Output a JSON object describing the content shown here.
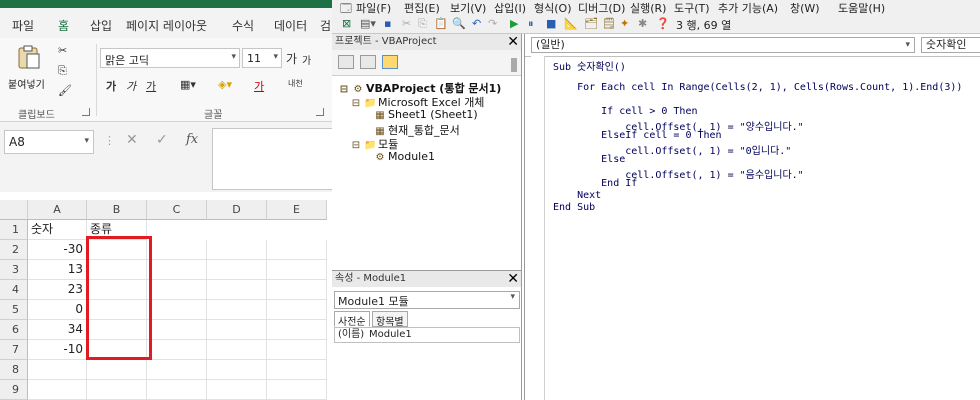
{
  "excel": {
    "tabs": [
      "파일",
      "홈",
      "삽입",
      "페이지 레이아웃",
      "수식",
      "데이터",
      "검"
    ],
    "active_tab": "홈",
    "ribbon": {
      "paste_label": "붙여넣기",
      "clipboard_label": "클립보드",
      "font_label": "글꼴",
      "font_name": "맑은 고딕",
      "font_size": "11",
      "grow_font": "가",
      "shrink_font": "가",
      "bold": "가",
      "italic": "가",
      "underline": "가",
      "font_color": "가",
      "phonetic": "내천"
    },
    "name_box": "A8",
    "fx_label": "fx",
    "columns": [
      "A",
      "B",
      "C",
      "D",
      "E"
    ],
    "rows": [
      "1",
      "2",
      "3",
      "4",
      "5",
      "6",
      "7",
      "8",
      "9"
    ],
    "cells": {
      "A1": "숫자",
      "B1": "종류",
      "A2": "-30",
      "A3": "13",
      "A4": "23",
      "A5": "0",
      "A6": "34",
      "A7": "-10"
    },
    "colors": {
      "excel_green": "#1e7145",
      "highlight": "#e11b22"
    }
  },
  "vbe": {
    "menu": [
      "파일(F)",
      "편집(E)",
      "보기(V)",
      "삽입(I)",
      "형식(O)",
      "디버그(D)",
      "실행(R)",
      "도구(T)",
      "추가 기능(A)",
      "창(W)",
      "도움말(H)"
    ],
    "cursor_pos": "3 행, 69 열",
    "project": {
      "title": "프로젝트 - VBAProject",
      "root": "VBAProject (통합 문서1)",
      "excel_objects": "Microsoft Excel 개체",
      "sheet1": "Sheet1 (Sheet1)",
      "workbook": "현재_통합_문서",
      "modules": "모듈",
      "module1": "Module1"
    },
    "properties": {
      "title": "속성 - Module1",
      "object": "Module1 모듈",
      "tab_alpha": "사전순",
      "tab_category": "항목별",
      "row_name": "(이름)",
      "row_value": "Module1"
    },
    "code": {
      "object_select": "(일반)",
      "procedure_select": "숫자확인",
      "lines": [
        "Sub 숫자확인()",
        "",
        "    For Each cell In Range(Cells(2, 1), Cells(Rows.Count, 1).End(3))",
        "",
        "        If cell > 0 Then",
        "            cell.Offset(, 1) = \"양수입니다.\"",
        "        ElseIf cell = 0 Then",
        "            cell.Offset(, 1) = \"0입니다.\"",
        "        Else",
        "            cell.Offset(, 1) = \"음수입니다.\"",
        "        End If",
        "    Next",
        "End Sub"
      ]
    }
  }
}
